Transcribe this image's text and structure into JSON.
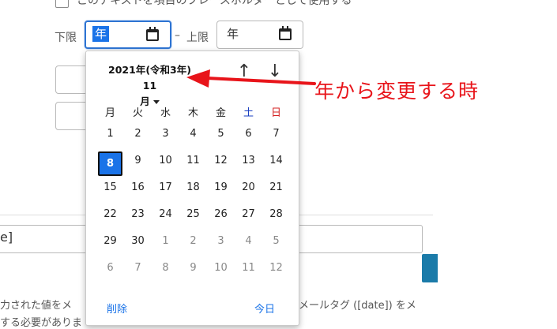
{
  "top_row": {
    "checkbox_label": "このテキストを項目のプレースホルダーとして使用する"
  },
  "range": {
    "lower_label": "下限",
    "lower_value": "年",
    "separator": "–",
    "upper_label": "上限",
    "upper_value": "年"
  },
  "background": {
    "field_text": "e]",
    "note_line1_left": "力された値をメ",
    "note_line1_right": "メールタグ ([date]) をメ",
    "note_line2": "する必要がありま"
  },
  "calendar": {
    "title_line1": "2021年(令和3年) 11",
    "title_line2": "月",
    "prev_label": "↑",
    "next_label": "↓",
    "weekdays": [
      "月",
      "火",
      "水",
      "木",
      "金",
      "土",
      "日"
    ],
    "weeks": [
      [
        "1",
        "2",
        "3",
        "4",
        "5",
        "6",
        "7"
      ],
      [
        "8",
        "9",
        "10",
        "11",
        "12",
        "13",
        "14"
      ],
      [
        "15",
        "16",
        "17",
        "18",
        "19",
        "20",
        "21"
      ],
      [
        "22",
        "23",
        "24",
        "25",
        "26",
        "27",
        "28"
      ],
      [
        "29",
        "30",
        "1",
        "2",
        "3",
        "4",
        "5"
      ],
      [
        "6",
        "7",
        "8",
        "9",
        "10",
        "11",
        "12"
      ]
    ],
    "clear_label": "削除",
    "today_label": "今日"
  },
  "annotation": {
    "text": "年から変更する時"
  },
  "colors": {
    "accent": "#1a73e8",
    "annotation": "#e8141a",
    "saturday": "#1a3fc0",
    "sunday": "#d42020"
  }
}
